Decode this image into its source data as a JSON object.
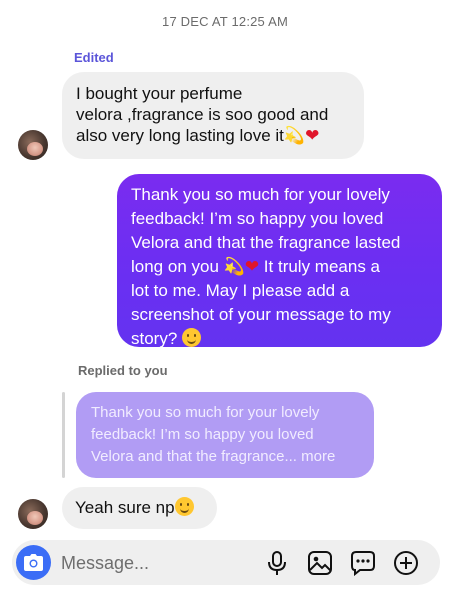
{
  "thread": {
    "timestamp": "17 DEC AT 12:25 AM"
  },
  "messages": [
    {
      "direction": "incoming",
      "label": "Edited",
      "lines": [
        "I bought your perfume",
        "velora ,fragrance is soo good and",
        "also very long lasting love it"
      ],
      "emojis": [
        "dizzy",
        "red-heart"
      ]
    },
    {
      "direction": "outgoing",
      "lines": [
        "Thank you so much for your lovely",
        "feedback! I’m so happy you loved",
        "Velora and that the fragrance lasted",
        "long on you",
        "It truly means a",
        "lot to me. May I please add a",
        "screenshot of your message to my",
        "story?"
      ],
      "emojis": [
        "dizzy",
        "red-heart",
        "smiling-face"
      ]
    },
    {
      "direction": "incoming",
      "reply_label": "Replied to you",
      "quote_lines": [
        "Thank you so much for your lovely",
        "feedback! I’m so happy you loved",
        "Velora and that the fragrance... more"
      ],
      "text": "Yeah sure np",
      "emojis": [
        "smiling-face"
      ]
    }
  ],
  "composer": {
    "placeholder": "Message...",
    "icons": [
      "camera-icon",
      "microphone-icon",
      "gallery-icon",
      "sticker-icon",
      "add-icon"
    ]
  },
  "colors": {
    "outgoing_bubble": "#6a2ff2",
    "incoming_bubble": "#efefef",
    "quote_bubble": "#b19cf4",
    "edited_label": "#5b55d9",
    "camera_button": "#3b6df6"
  }
}
